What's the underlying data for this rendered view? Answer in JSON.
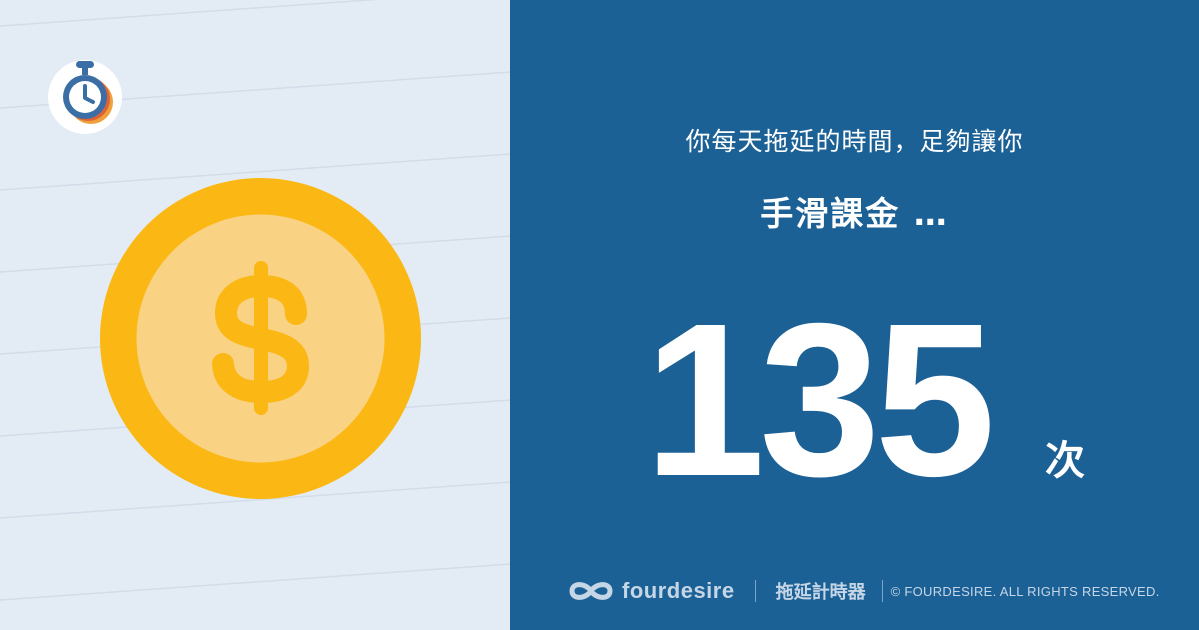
{
  "headline": "你每天拖延的時間，足夠讓你",
  "activity": "手滑課金 …",
  "count": {
    "value": "135",
    "unit": "次"
  },
  "footer": {
    "brand": "fourdesire",
    "product": "拖延計時器",
    "copyright": "© FOURDESIRE. ALL RIGHTS RESERVED."
  },
  "icons": {
    "logo": "stopwatch-icon",
    "coin": "dollar-coin-icon",
    "brand": "infinity-icon"
  },
  "colors": {
    "left_background": "#e3ecf5",
    "right_background": "#1c6196",
    "coin_outer": "#fbb713",
    "coin_inner": "#f9d284",
    "footer_text": "#c5d6e6"
  }
}
